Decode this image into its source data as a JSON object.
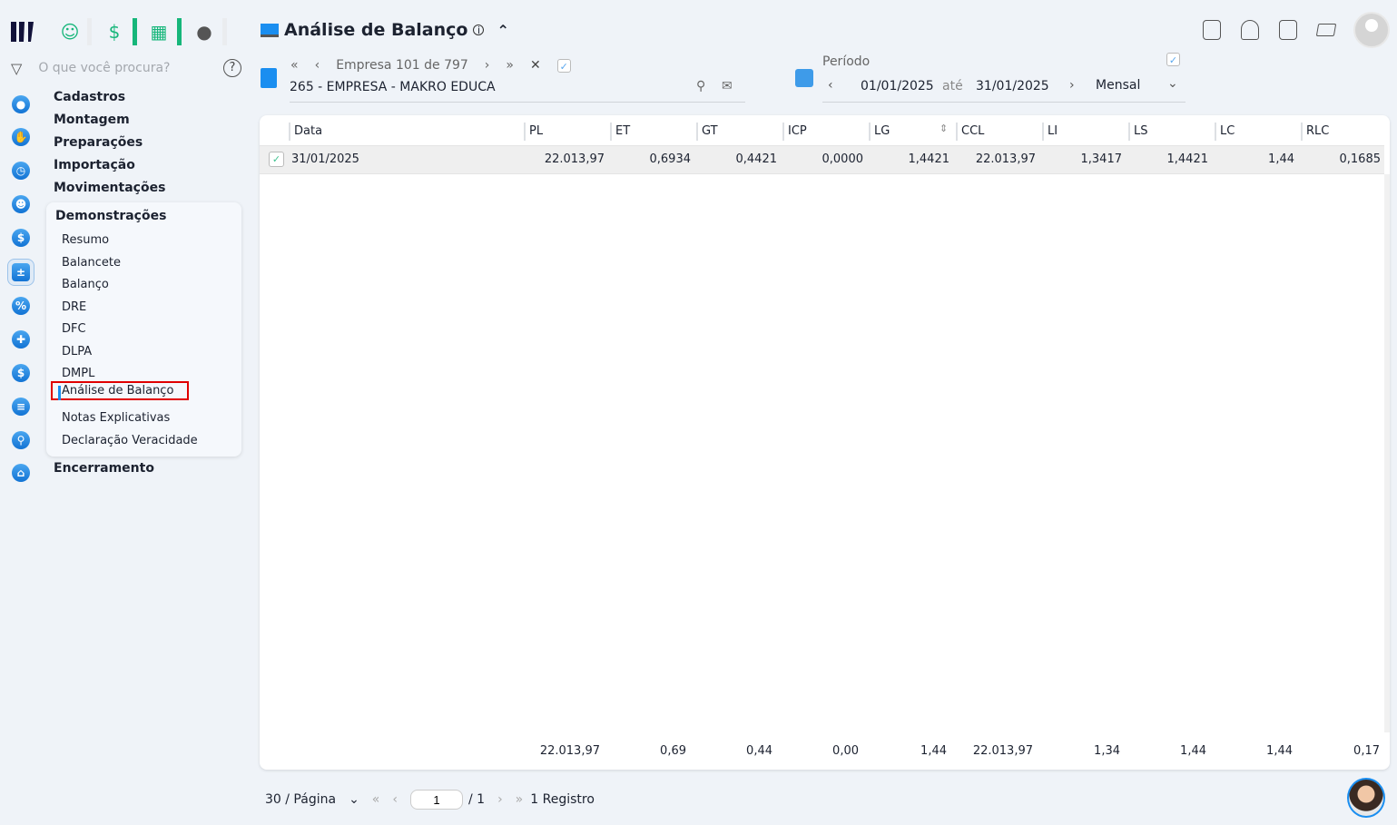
{
  "header": {
    "title": "Análise de Balanço",
    "company_nav": "Empresa 101 de 797",
    "company": "265 - EMPRESA - MAKRO EDUCA"
  },
  "search": {
    "placeholder": "O que você procura?"
  },
  "period": {
    "label": "Período",
    "start": "01/01/2025",
    "sep": "até",
    "end": "31/01/2025",
    "mode": "Mensal"
  },
  "menu": {
    "items": [
      "Cadastros",
      "Montagem",
      "Preparações",
      "Importação",
      "Movimentações"
    ],
    "group": "Demonstrações",
    "sub": [
      "Resumo",
      "Balancete",
      "Balanço",
      "DRE",
      "DFC",
      "DLPA",
      "DMPL",
      "Análise de Balanço",
      "Notas Explicativas",
      "Declaração Veracidade"
    ],
    "active": "Análise de Balanço",
    "last": "Encerramento"
  },
  "table": {
    "columns": [
      "Data",
      "PL",
      "ET",
      "GT",
      "ICP",
      "LG",
      "CCL",
      "LI",
      "LS",
      "LC",
      "RLC"
    ],
    "rows": [
      [
        "31/01/2025",
        "22.013,97",
        "0,6934",
        "0,4421",
        "0,0000",
        "1,4421",
        "22.013,97",
        "1,3417",
        "1,4421",
        "1,44",
        "0,1685"
      ]
    ],
    "totals": [
      "22.013,97",
      "0,69",
      "0,44",
      "0,00",
      "1,44",
      "22.013,97",
      "1,34",
      "1,44",
      "1,44",
      "0,17"
    ]
  },
  "pager": {
    "per_page": "30 / Página",
    "page": "1",
    "of": "/ 1",
    "records": "1 Registro"
  },
  "colors": {
    "accent": "#1a8ef0",
    "green": "#16b67a",
    "highlight": "#e00000"
  }
}
